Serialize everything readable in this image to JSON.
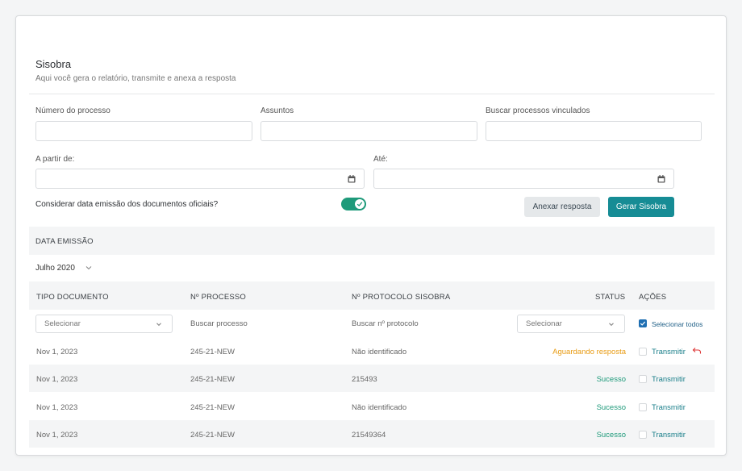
{
  "header": {
    "title": "Sisobra",
    "subtitle": "Aqui você gera o relatório, transmite e anexa a resposta"
  },
  "filters": {
    "process_label": "Número do processo",
    "subjects_label": "Assuntos",
    "linked_label": "Buscar processos vinculados",
    "from_label": "A partir de:",
    "to_label": "Até:",
    "toggle_label": "Considerar data emissão dos documentos oficiais?",
    "toggle_on": true
  },
  "actions": {
    "attach_label": "Anexar resposta",
    "generate_label": "Gerar Sisobra"
  },
  "section": {
    "date_header": "DATA EMISSÃO",
    "month": "Julho 2020"
  },
  "table": {
    "columns": {
      "type": "TIPO DOCUMENTO",
      "process": "Nº PROCESSO",
      "protocol": "Nº PROTOCOLO SISOBRA",
      "status": "STATUS",
      "actions": "AÇÕES"
    },
    "filter_row": {
      "type_placeholder": "Selecionar",
      "process_placeholder": "Buscar processo",
      "protocol_placeholder": "Buscar nº protocolo",
      "status_placeholder": "Selecionar",
      "select_all": "Selecionar todos"
    },
    "rows": [
      {
        "date": "Nov 1, 2023",
        "process": "245-21-NEW",
        "protocol": "Não identificado",
        "status": "Aguardando resposta",
        "status_kind": "waiting",
        "action": "Transmitir"
      },
      {
        "date": "Nov 1, 2023",
        "process": "245-21-NEW",
        "protocol": "215493",
        "status": "Sucesso",
        "status_kind": "success",
        "action": "Transmitir"
      },
      {
        "date": "Nov 1, 2023",
        "process": "245-21-NEW",
        "protocol": "Não identificado",
        "status": "Sucesso",
        "status_kind": "success",
        "action": "Transmitir"
      },
      {
        "date": "Nov 1, 2023",
        "process": "245-21-NEW",
        "protocol": "21549364",
        "status": "Sucesso",
        "status_kind": "success",
        "action": "Transmitir"
      }
    ]
  },
  "colors": {
    "accent": "#168c95",
    "success": "#1e9a7a",
    "waiting": "#e89b13",
    "toggle": "#1e9a7a"
  }
}
